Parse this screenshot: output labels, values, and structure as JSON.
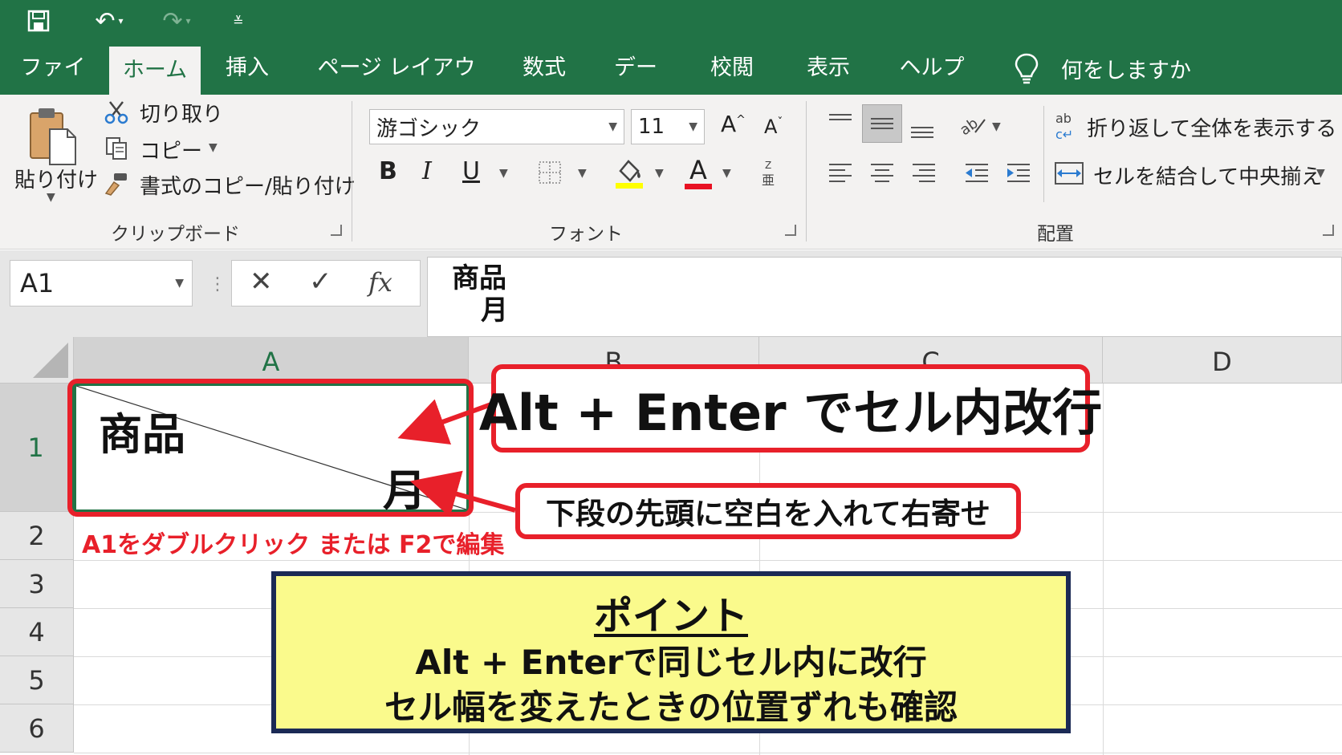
{
  "quick_access": {
    "save_icon": "save-icon",
    "undo_icon": "undo-icon",
    "redo_icon": "redo-icon",
    "customize_icon": "customize-icon"
  },
  "tabs": [
    {
      "label": "ファイル"
    },
    {
      "label": "ホーム"
    },
    {
      "label": "挿入"
    },
    {
      "label": "ページ レイアウト"
    },
    {
      "label": "数式"
    },
    {
      "label": "データ"
    },
    {
      "label": "校閲"
    },
    {
      "label": "表示"
    },
    {
      "label": "ヘルプ"
    }
  ],
  "tell_me": "何をしますか",
  "clipboard": {
    "paste": "貼り付け",
    "cut": "切り取り",
    "copy": "コピー",
    "format_painter": "書式のコピー/貼り付け",
    "group": "クリップボード"
  },
  "font": {
    "name": "游ゴシック",
    "size": "11",
    "bold": "B",
    "italic": "I",
    "underline": "U",
    "grow": "A",
    "shrink": "A",
    "font_color_letter": "A",
    "group": "フォント",
    "fill_color": "#ffff00",
    "text_color": "#e81123"
  },
  "alignment": {
    "wrap_text": "折り返して全体を表示する",
    "merge_center": "セルを結合して中央揃え",
    "group": "配置"
  },
  "formula_bar": {
    "name_box": "A1",
    "cancel": "✕",
    "enter": "✓",
    "fx": "fx",
    "line1": "商品",
    "line2": "月"
  },
  "grid": {
    "columns": [
      "A",
      "B",
      "C",
      "D"
    ],
    "rows": [
      "1",
      "2",
      "3",
      "4",
      "5",
      "6"
    ],
    "cell_a1_line1": "商品",
    "cell_a1_line2": "月",
    "accent": "#217346"
  },
  "annotations": {
    "callout_main": "Alt + Enter でセル内改行",
    "callout_sub": "下段の先頭に空白を入れて右寄せ",
    "edit_hint": "A1をダブルクリック または F2で編集",
    "point_title": "ポイント",
    "point_line1": "Alt + Enterで同じセル内に改行",
    "point_line2": "セル幅を変えたときの位置ずれも確認",
    "highlight_color": "#e8202a",
    "point_bg": "#fafa8c"
  }
}
